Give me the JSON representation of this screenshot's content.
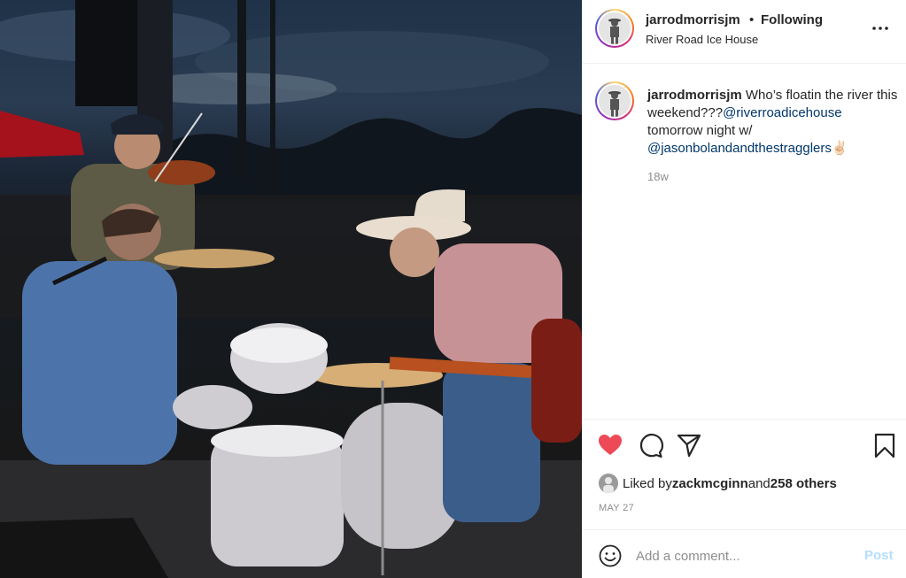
{
  "post": {
    "username": "jarrodmorrisjm",
    "separator": "•",
    "follow_status": "Following",
    "location": "River Road Ice House",
    "more_icon": "more-horizontal-icon"
  },
  "caption": {
    "username": "jarrodmorrisjm",
    "part1": " Who’s floatin the river this weekend???",
    "mention1": "@riverroadicehouse",
    "part2": " tomorrow night w/ ",
    "mention2": "@jasonbolandandthestragglers",
    "emoji": "✌🏻",
    "time": "18w"
  },
  "actions": {
    "liked": true,
    "heart_color": "#ed4956",
    "icons": [
      "heart-icon",
      "comment-icon",
      "share-icon",
      "bookmark-icon"
    ]
  },
  "likes": {
    "prefix": "Liked by ",
    "user": "zackmcginn",
    "and": " and ",
    "others": "258 others"
  },
  "date": "MAY 27",
  "comment": {
    "placeholder": "Add a comment...",
    "post_label": "Post"
  }
}
